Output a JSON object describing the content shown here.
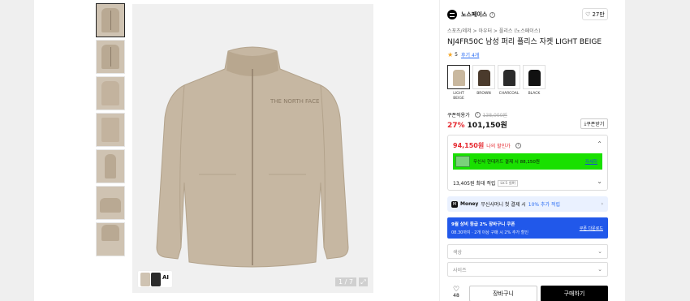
{
  "gallery": {
    "counter": "1 / 7",
    "ai_label": "AI",
    "thumbnail_count": 7
  },
  "brand": {
    "name": "노스페이스",
    "like_count": "27만"
  },
  "product": {
    "breadcrumb": "스포츠/레저 > 아우터 > 플리스 (노스페이스)",
    "title": "NJ4FR50C 남성 퍼리 플리스 자켓 LIGHT BEIGE",
    "rating": "5",
    "review_link": "후기 4개"
  },
  "colors": [
    {
      "name": "LIGHT BEIGE",
      "hex": "#c9b89f",
      "selected": true
    },
    {
      "name": "BROWN",
      "hex": "#4a3a2c",
      "selected": false
    },
    {
      "name": "CHARCOAL",
      "hex": "#2b2b2b",
      "selected": false
    },
    {
      "name": "BLACK",
      "hex": "#111111",
      "selected": false
    }
  ],
  "pricing": {
    "coupon_label": "쿠폰적용가",
    "original_price": "138,000원",
    "discount_rate": "27%",
    "sale_price": "101,150원",
    "coupon_button": "쿠폰받기"
  },
  "benefit": {
    "best_price": "94,150원",
    "best_price_text": "나의 할인가",
    "card_text": "무신사 현대카드 결제 시 88,150원",
    "card_detail": "자세히",
    "points_text": "13,405원 최대 적립",
    "level": "LV.5 실버"
  },
  "money_banner": {
    "prefix": "Money",
    "text": "무신사머니 첫 결제 시",
    "highlight": "10% 추가 적립"
  },
  "promo_banner": {
    "line1": "9월 상비 등급 2% 장바구니 쿠폰",
    "line2": "08.30까지 · 2개 이상 구매 시 2% 추가 할인",
    "link": "쿠폰 다운로드"
  },
  "selects": {
    "color_placeholder": "색상",
    "size_placeholder": "사이즈"
  },
  "actions": {
    "like_count": "48",
    "cart": "장바구니",
    "buy": "구매하기"
  },
  "accent": {
    "sale_red": "#e5282f",
    "promo_blue": "#2158ea",
    "card_green": "#19e000"
  }
}
